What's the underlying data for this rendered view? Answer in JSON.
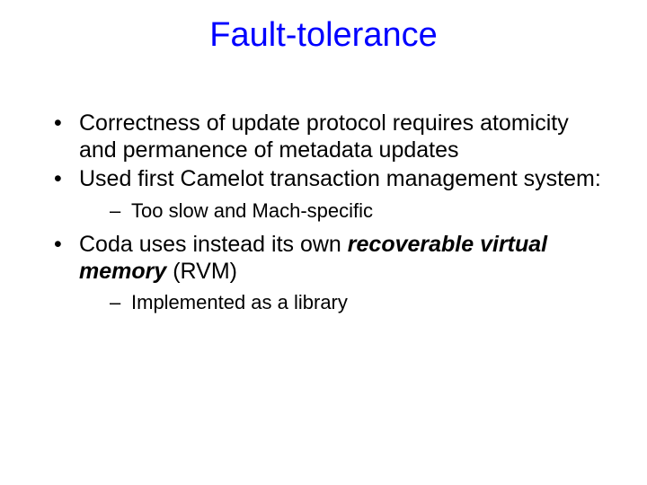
{
  "title": "Fault-tolerance",
  "bullets": {
    "b1": "Correctness of update protocol requires atomicity and permanence of metadata updates",
    "b2": "Used first Camelot transaction management system:",
    "b2_sub1": "Too slow and Mach-specific",
    "b3_pre": "Coda uses instead its own ",
    "b3_em": "recoverable virtual memory",
    "b3_post": " (RVM)",
    "b3_sub1": "Implemented as a library"
  }
}
